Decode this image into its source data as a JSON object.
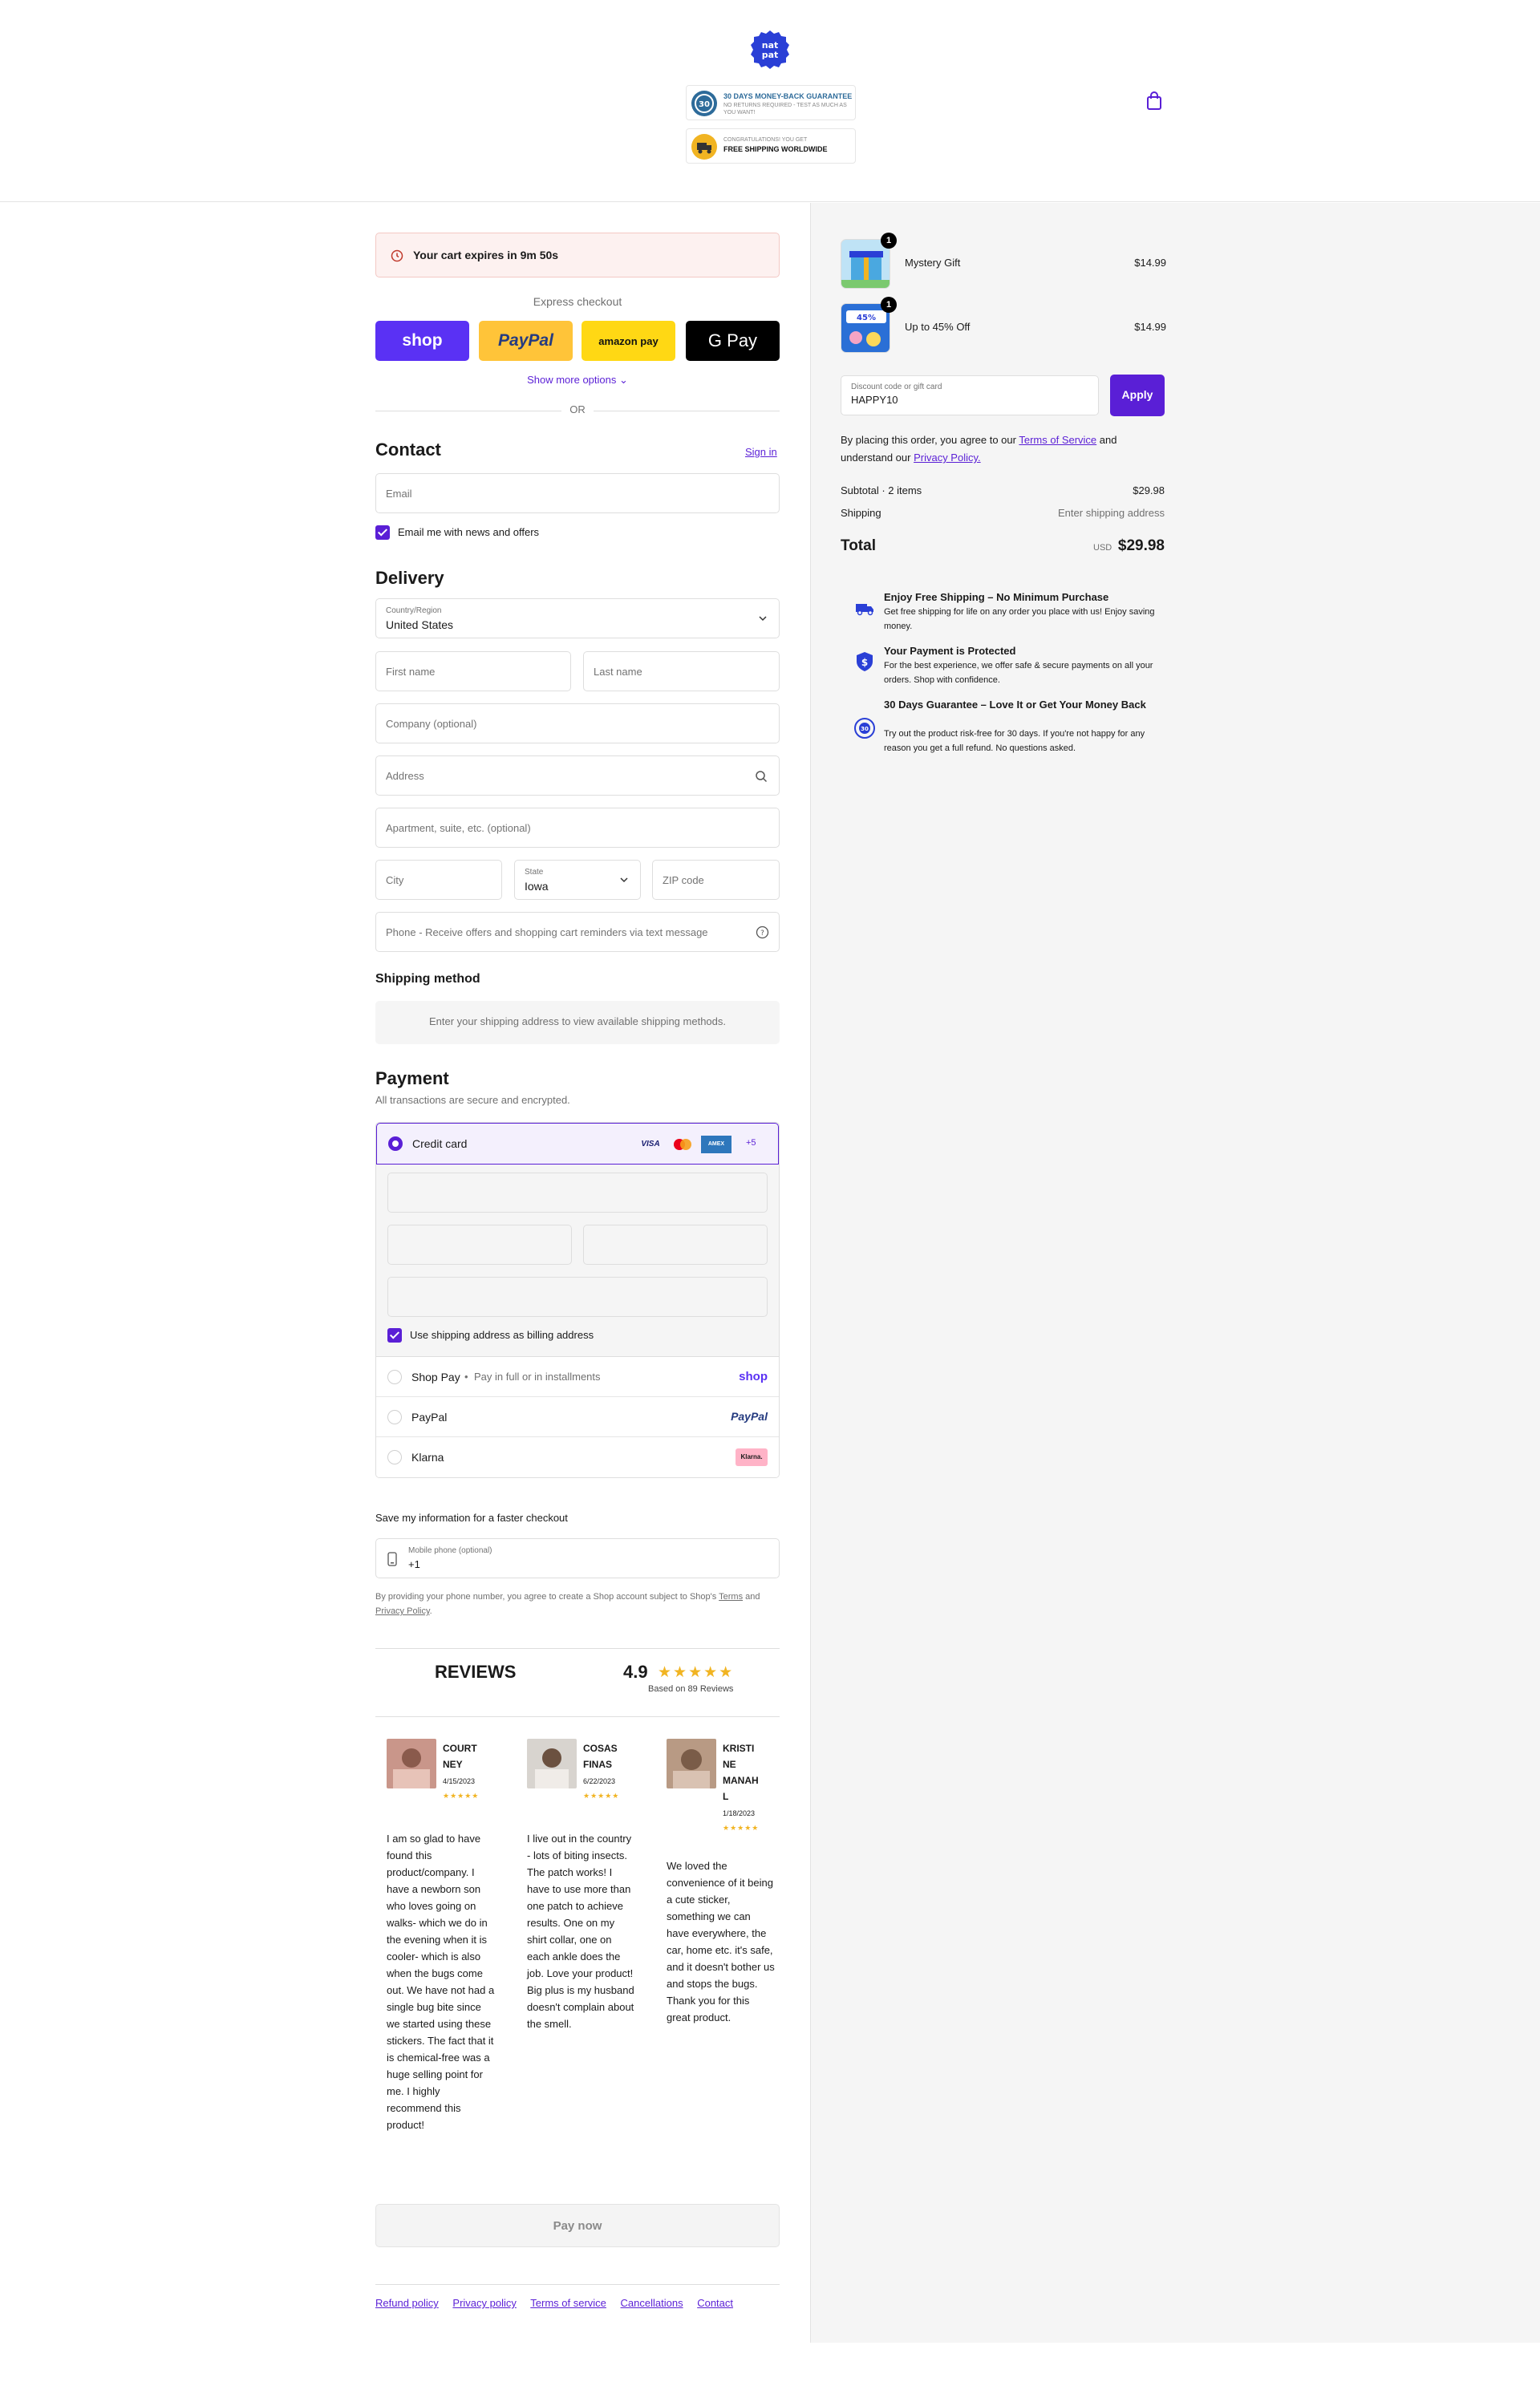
{
  "brand": {
    "name": "NATPAT",
    "accent": "#5a1fd6",
    "logo_color": "#2a3fd6"
  },
  "header": {
    "badges": [
      {
        "title": "30 DAYS MONEY-BACK GUARANTEE",
        "subtitle": "NO RETURNS REQUIRED - TEST AS MUCH AS YOU WANT!",
        "icon": "guarantee-seal-icon"
      },
      {
        "title": "CONGRATULATIONS! YOU GET",
        "subtitle": "FREE SHIPPING WORLDWIDE",
        "icon": "shipping-truck-icon"
      }
    ],
    "cart_icon": "shopping-bag-icon"
  },
  "timer": {
    "text": "Your cart expires in 9m 50s"
  },
  "express": {
    "label": "Express checkout",
    "buttons": [
      {
        "label": "shop",
        "color": "#5a31f4"
      },
      {
        "label": "PayPal",
        "color": "#ffc439"
      },
      {
        "label": "amazon pay",
        "color": "#ffd814"
      },
      {
        "label": "G Pay",
        "color": "#000000"
      }
    ],
    "show_more": "Show more options",
    "or": "OR"
  },
  "contact": {
    "title": "Contact",
    "sign_in": "Sign in",
    "email_placeholder": "Email",
    "newsletter_label": "Email me with news and offers"
  },
  "delivery": {
    "title": "Delivery",
    "country_label": "Country/Region",
    "country_value": "United States",
    "first_name": "First name",
    "last_name": "Last name",
    "company": "Company (optional)",
    "address": "Address",
    "apartment": "Apartment, suite, etc. (optional)",
    "city": "City",
    "state_label": "State",
    "state_value": "Iowa",
    "zip": "ZIP code",
    "phone": "Phone - Receive offers and shopping cart reminders via text message"
  },
  "shipping_method": {
    "title": "Shipping method",
    "message": "Enter your shipping address to view available shipping methods."
  },
  "payment": {
    "title": "Payment",
    "subtitle": "All transactions are secure and encrypted.",
    "credit_card_label": "Credit card",
    "card_logos": [
      "VISA",
      "mastercard",
      "AMEX"
    ],
    "more_cards": "+5",
    "billing_same_label": "Use shipping address as billing address",
    "options": [
      {
        "name": "Shop Pay",
        "detail": "Pay in full or in installments",
        "logo": "shop"
      },
      {
        "name": "PayPal",
        "detail": "",
        "logo": "PayPal"
      },
      {
        "name": "Klarna",
        "detail": "",
        "logo": "Klarna."
      }
    ]
  },
  "save_info": {
    "title": "Save my information for a faster checkout",
    "phone_label": "Mobile phone (optional)",
    "phone_value": "+1",
    "fine_print_1": "By providing your phone number, you agree to create a Shop account subject to Shop's",
    "terms": "Terms",
    "and": "and",
    "privacy": "Privacy Policy",
    "period": "."
  },
  "reviews": {
    "title": "REVIEWS",
    "rating": "4.9",
    "stars": "★★★★★",
    "based_on": "Based on 89 Reviews",
    "items": [
      {
        "name": "COURTNEY",
        "date": "4/15/2023",
        "stars": "★★★★★",
        "text": "I am so glad to have found this product/company. I have a newborn son who loves going on walks- which we do in the evening when it is cooler- which is also when the bugs come out. We have not had a single bug bite since we started using these stickers. The fact that it is chemical-free was a huge selling point for me. I highly recommend this product!"
      },
      {
        "name": "COSAS FINAS",
        "date": "6/22/2023",
        "stars": "★★★★★",
        "text": "I live out in the country - lots of biting insects. The patch works! I have to use more than one patch to achieve results. One on my shirt collar, one on each ankle does the job. Love your product! Big plus is my husband doesn't complain about the smell."
      },
      {
        "name": "KRISTINE MANAHL",
        "date": "1/18/2023",
        "stars": "★★★★★",
        "text": "We loved the convenience of it being a cute sticker, something we can have everywhere, the car, home etc. it's safe, and it doesn't bother us and stops the bugs. Thank you for this great product."
      }
    ]
  },
  "pay_now": "Pay now",
  "footer": {
    "links": [
      "Refund policy",
      "Privacy policy",
      "Terms of service",
      "Cancellations",
      "Contact"
    ]
  },
  "summary": {
    "items": [
      {
        "name": "Mystery Gift",
        "price": "$14.99",
        "qty": "1",
        "thumb_color": "#4aa8e0"
      },
      {
        "name": "Up to 45% Off",
        "price": "$14.99",
        "qty": "1",
        "thumb_color": "#2a6fd6"
      }
    ],
    "discount_label": "Discount code or gift card",
    "discount_value": "HAPPY10",
    "apply": "Apply",
    "agree_1": "By placing this order, you agree to our",
    "terms": "Terms of Service",
    "agree_2": "and understand our",
    "privacy": "Privacy Policy.",
    "subtotal_label": "Subtotal · 2 items",
    "subtotal_value": "$29.98",
    "shipping_label": "Shipping",
    "shipping_value": "Enter shipping address",
    "total_label": "Total",
    "total_currency": "USD",
    "total_value": "$29.98",
    "perks": [
      {
        "title": "Enjoy Free Shipping – No Minimum Purchase",
        "desc": "Get free shipping for life on any order you place with us! Enjoy saving money.",
        "icon": "truck-icon"
      },
      {
        "title": "Your Payment is Protected",
        "desc": "For the best experience, we offer safe & secure payments on all your orders. Shop with confidence.",
        "icon": "shield-dollar-icon"
      },
      {
        "title": "30 Days Guarantee – Love It or Get Your Money Back",
        "desc": "Try out the product risk-free for 30 days. If you're not happy for any reason you get a full refund. No questions asked.",
        "icon": "guarantee-badge-icon"
      }
    ]
  }
}
